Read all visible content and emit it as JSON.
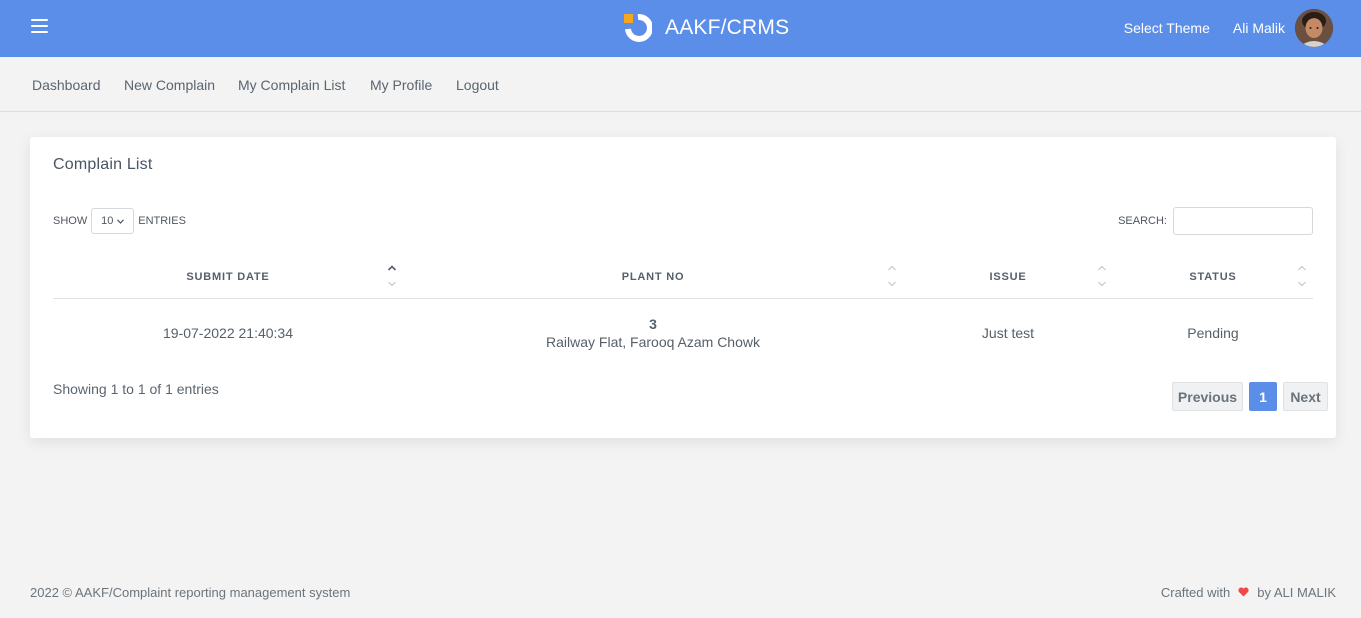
{
  "header": {
    "app_title": "AAKF/CRMS",
    "select_theme": "Select Theme",
    "user_name": "Ali Malik",
    "brand_colors": {
      "header_bg": "#5b8ee8",
      "logo_orange": "#f5a623"
    }
  },
  "nav": {
    "items": [
      {
        "label": "Dashboard"
      },
      {
        "label": "New Complain"
      },
      {
        "label": "My Complain List"
      },
      {
        "label": "My Profile"
      },
      {
        "label": "Logout"
      }
    ]
  },
  "card": {
    "title": "Complain List",
    "show_label": "SHOW",
    "entries_value": "10",
    "entries_label": "ENTRIES",
    "search_label": "SEARCH:",
    "search_value": "",
    "columns": [
      {
        "label": "SUBMIT DATE",
        "sorted": "asc"
      },
      {
        "label": "PLANT NO",
        "sorted": "none"
      },
      {
        "label": "ISSUE",
        "sorted": "none"
      },
      {
        "label": "STATUS",
        "sorted": "none"
      }
    ],
    "rows": [
      {
        "submit_date": "19-07-2022 21:40:34",
        "plant_no": "3",
        "plant_address": "Railway Flat, Farooq Azam Chowk",
        "issue": "Just test",
        "status": "Pending"
      }
    ],
    "info": "Showing 1 to 1 of 1 entries",
    "pagination": {
      "previous": "Previous",
      "current_page": "1",
      "next": "Next"
    }
  },
  "footer": {
    "copyright": "2022 © AAKF/Complaint reporting management system",
    "crafted_with": "Crafted with",
    "crafted_by": "by ALI MALIK",
    "heart_color": "#f0494a"
  }
}
